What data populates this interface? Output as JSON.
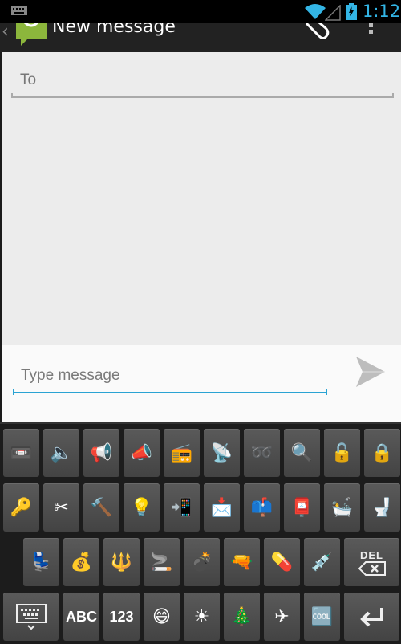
{
  "status_bar": {
    "time": "1:12",
    "icons": [
      "keyboard-icon",
      "wifi-icon",
      "signal-icon",
      "battery-charging-icon"
    ]
  },
  "action_bar": {
    "title": "New message",
    "icons": [
      "back-icon",
      "messaging-app-icon",
      "attach-icon",
      "overflow-menu-icon"
    ]
  },
  "recipient": {
    "label": "To"
  },
  "compose": {
    "placeholder": "Type message",
    "value": "",
    "send_icon": "send-icon",
    "accent_color": "#2aa3d3"
  },
  "keyboard": {
    "rows": [
      [
        {
          "icon": "vhs-tape-icon",
          "glyph": "📼"
        },
        {
          "icon": "speaker-icon",
          "glyph": "🔈"
        },
        {
          "icon": "megaphone-icon",
          "glyph": "📢"
        },
        {
          "icon": "bell-horn-icon",
          "glyph": "📣"
        },
        {
          "icon": "radio-icon",
          "glyph": "📻"
        },
        {
          "icon": "satellite-dish-icon",
          "glyph": "📡"
        },
        {
          "icon": "voicemail-icon",
          "glyph": "➿"
        },
        {
          "icon": "magnifier-icon",
          "glyph": "🔍"
        },
        {
          "icon": "unlocked-icon",
          "glyph": "🔓"
        },
        {
          "icon": "locked-icon",
          "glyph": "🔒"
        }
      ],
      [
        {
          "icon": "key-icon",
          "glyph": "🔑"
        },
        {
          "icon": "scissors-icon",
          "glyph": "✂"
        },
        {
          "icon": "hammer-icon",
          "glyph": "🔨"
        },
        {
          "icon": "light-bulb-icon",
          "glyph": "💡"
        },
        {
          "icon": "phone-incoming-icon",
          "glyph": "📲"
        },
        {
          "icon": "envelope-incoming-icon",
          "glyph": "📩"
        },
        {
          "icon": "mailbox-icon",
          "glyph": "📫"
        },
        {
          "icon": "postbox-icon",
          "glyph": "📮"
        },
        {
          "icon": "bathtub-icon",
          "glyph": "🛀"
        },
        {
          "icon": "toilet-icon",
          "glyph": "🚽"
        }
      ],
      [
        {
          "icon": "seat-icon",
          "glyph": "💺"
        },
        {
          "icon": "money-bag-icon",
          "glyph": "💰"
        },
        {
          "icon": "trident-icon",
          "glyph": "🔱"
        },
        {
          "icon": "cigarette-icon",
          "glyph": "🚬"
        },
        {
          "icon": "bomb-icon",
          "glyph": "💣"
        },
        {
          "icon": "gun-icon",
          "glyph": "🔫"
        },
        {
          "icon": "pill-icon",
          "glyph": "💊"
        },
        {
          "icon": "syringe-icon",
          "glyph": "💉"
        }
      ],
      [
        {
          "icon": "smile-icon",
          "glyph": "😄"
        },
        {
          "icon": "sun-icon",
          "glyph": "☀"
        },
        {
          "icon": "christmas-tree-icon",
          "glyph": "🎄"
        },
        {
          "icon": "airplane-icon",
          "glyph": "✈"
        },
        {
          "icon": "cool-icon",
          "glyph": "🆒"
        }
      ]
    ],
    "del_label": "DEL",
    "abc_label": "ABC",
    "num_label": "123"
  }
}
